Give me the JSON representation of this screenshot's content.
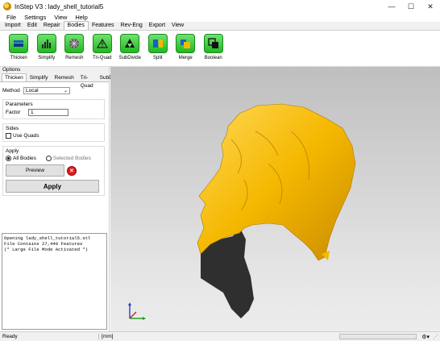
{
  "window": {
    "title": "InStep V3 : lady_shell_tutorial5",
    "minimize": "—",
    "maximize": "☐",
    "close": "✕"
  },
  "menubar": [
    "File",
    "Settings",
    "View",
    "Help"
  ],
  "ribbon_tabs": [
    "Import",
    "Edit",
    "Repair",
    "Bodies",
    "Features",
    "Rev-Eng",
    "Export",
    "View"
  ],
  "ribbon_active": "Bodies",
  "tools": [
    {
      "label": "Thicken",
      "icon": "thicken-icon"
    },
    {
      "label": "Simplify",
      "icon": "simplify-icon"
    },
    {
      "label": "Remesh",
      "icon": "remesh-icon"
    },
    {
      "label": "Tri-Quad",
      "icon": "tri-quad-icon"
    },
    {
      "label": "SubDivide",
      "icon": "subdivide-icon"
    },
    {
      "label": "Split",
      "icon": "split-icon"
    },
    {
      "label": "Merge",
      "icon": "merge-icon"
    },
    {
      "label": "Boolean",
      "icon": "boolean-icon"
    }
  ],
  "options": {
    "header": "Options",
    "subtabs": [
      "Thicken",
      "Simplify",
      "Remesh",
      "Tri-Quad",
      "SubD"
    ],
    "method_label": "Method",
    "method_value": "Local",
    "parameters_title": "Parameters",
    "factor_label": "Factor",
    "factor_value": "1",
    "sides_title": "Sides",
    "use_quads_label": "Use Quads",
    "apply_title": "Apply",
    "all_bodies_label": "All Bodies",
    "selected_bodies_label": "Selected Bodies",
    "preview_label": "Preview",
    "apply_label": "Apply"
  },
  "log": {
    "lines": [
      "Opening lady_shell_tutorial5.stl",
      "File Contains 27,440 Features",
      "(* Large File Mode Activated *)"
    ]
  },
  "status": {
    "ready": "Ready",
    "units": "[mm]"
  },
  "colors": {
    "model_yellow": "#f5b800",
    "model_shadow": "#2f2f2f",
    "tool_green": "#22b822"
  }
}
